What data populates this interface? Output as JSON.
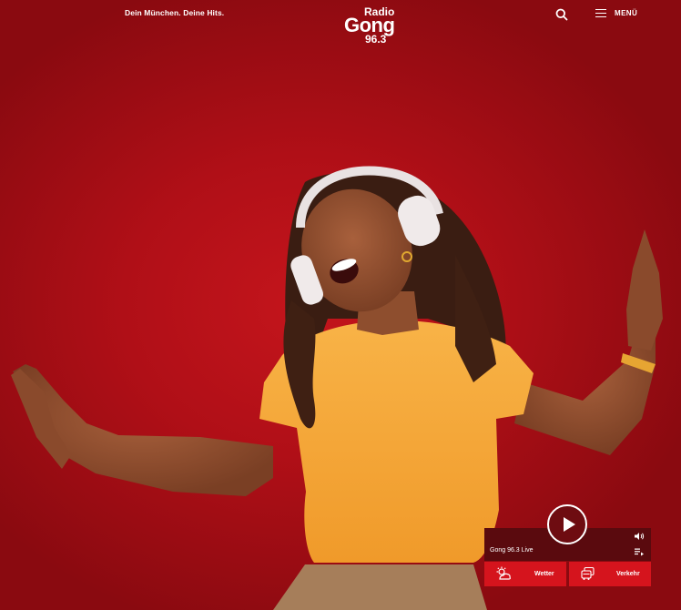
{
  "header": {
    "tagline": "Dein München. Deine Hits.",
    "logo": {
      "line1": "Radio",
      "line2": "Gong",
      "line3": "96.3"
    },
    "menu_label": "MENÜ"
  },
  "player": {
    "station_label": "Gong 96.3 Live"
  },
  "infobar": {
    "weather_label": "Wetter",
    "traffic_label": "Verkehr"
  },
  "colors": {
    "background": "#b40d16",
    "accent": "#d5141d",
    "player_bg": "#5a0a0e",
    "shirt": "#f6a93b"
  }
}
